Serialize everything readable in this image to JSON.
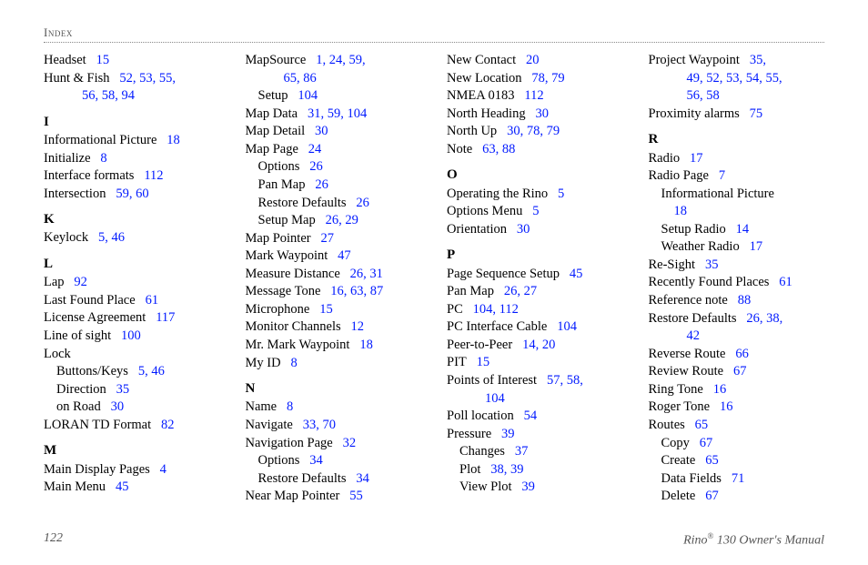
{
  "header": {
    "running": "Index"
  },
  "footer": {
    "page": "122",
    "title_pre": "Rino",
    "reg": "®",
    "title_post": " 130 Owner's Manual"
  },
  "cols": [
    [
      {
        "t": "entry",
        "term": "Headset",
        "pages": "15"
      },
      {
        "t": "entry",
        "term": "Hunt & Fish",
        "pages": "52, 53, 55,"
      },
      {
        "t": "cont",
        "pages": "56, 58, 94"
      },
      {
        "t": "letter",
        "text": "I"
      },
      {
        "t": "entry",
        "term": "Informational Picture",
        "pages": "18"
      },
      {
        "t": "entry",
        "term": "Initialize",
        "pages": "8"
      },
      {
        "t": "entry",
        "term": "Interface formats",
        "pages": "112"
      },
      {
        "t": "entry",
        "term": "Intersection",
        "pages": "59, 60"
      },
      {
        "t": "letter",
        "text": "K"
      },
      {
        "t": "entry",
        "term": "Keylock",
        "pages": "5, 46"
      },
      {
        "t": "letter",
        "text": "L"
      },
      {
        "t": "entry",
        "term": "Lap",
        "pages": "92"
      },
      {
        "t": "entry",
        "term": "Last Found Place",
        "pages": "61"
      },
      {
        "t": "entry",
        "term": "License Agreement",
        "pages": "117"
      },
      {
        "t": "entry",
        "term": "Line of sight",
        "pages": "100"
      },
      {
        "t": "entry",
        "term": "Lock",
        "pages": ""
      },
      {
        "t": "sub1",
        "term": "Buttons/Keys",
        "pages": "5, 46"
      },
      {
        "t": "sub1",
        "term": "Direction",
        "pages": "35"
      },
      {
        "t": "sub1",
        "term": "on Road",
        "pages": "30"
      },
      {
        "t": "entry",
        "term": "LORAN TD Format",
        "pages": "82"
      },
      {
        "t": "letter",
        "text": "M"
      },
      {
        "t": "entry",
        "term": "Main Display Pages",
        "pages": "4"
      },
      {
        "t": "entry",
        "term": "Main Menu",
        "pages": "45"
      }
    ],
    [
      {
        "t": "entry",
        "term": "MapSource",
        "pages": "1, 24, 59,"
      },
      {
        "t": "cont",
        "pages": "65, 86"
      },
      {
        "t": "sub1",
        "term": "Setup",
        "pages": "104"
      },
      {
        "t": "entry",
        "term": "Map Data",
        "pages": "31, 59, 104"
      },
      {
        "t": "entry",
        "term": "Map Detail",
        "pages": "30"
      },
      {
        "t": "entry",
        "term": "Map Page",
        "pages": "24"
      },
      {
        "t": "sub1",
        "term": "Options",
        "pages": "26"
      },
      {
        "t": "sub1",
        "term": "Pan Map",
        "pages": "26"
      },
      {
        "t": "sub1",
        "term": "Restore Defaults",
        "pages": "26"
      },
      {
        "t": "sub1",
        "term": "Setup Map",
        "pages": "26, 29"
      },
      {
        "t": "entry",
        "term": "Map Pointer",
        "pages": "27"
      },
      {
        "t": "entry",
        "term": "Mark Waypoint",
        "pages": "47"
      },
      {
        "t": "entry",
        "term": "Measure Distance",
        "pages": "26, 31"
      },
      {
        "t": "entry",
        "term": "Message Tone",
        "pages": "16, 63, 87"
      },
      {
        "t": "entry",
        "term": "Microphone",
        "pages": "15"
      },
      {
        "t": "entry",
        "term": "Monitor Channels",
        "pages": "12"
      },
      {
        "t": "entry",
        "term": "Mr. Mark Waypoint",
        "pages": "18"
      },
      {
        "t": "entry",
        "term": "My ID",
        "pages": "8"
      },
      {
        "t": "letter",
        "text": "N"
      },
      {
        "t": "entry",
        "term": "Name",
        "pages": "8"
      },
      {
        "t": "entry",
        "term": "Navigate",
        "pages": "33, 70"
      },
      {
        "t": "entry",
        "term": "Navigation Page",
        "pages": "32"
      },
      {
        "t": "sub1",
        "term": "Options",
        "pages": "34"
      },
      {
        "t": "sub1",
        "term": "Restore Defaults",
        "pages": "34"
      },
      {
        "t": "entry",
        "term": "Near Map Pointer",
        "pages": "55"
      }
    ],
    [
      {
        "t": "entry",
        "term": "New Contact",
        "pages": "20"
      },
      {
        "t": "entry",
        "term": "New Location",
        "pages": "78, 79"
      },
      {
        "t": "entry",
        "term": "NMEA 0183",
        "pages": "112"
      },
      {
        "t": "entry",
        "term": "North Heading",
        "pages": "30"
      },
      {
        "t": "entry",
        "term": "North Up",
        "pages": "30, 78, 79"
      },
      {
        "t": "entry",
        "term": "Note",
        "pages": "63, 88"
      },
      {
        "t": "letter",
        "text": "O"
      },
      {
        "t": "entry",
        "term": "Operating the Rino",
        "pages": "5"
      },
      {
        "t": "entry",
        "term": "Options Menu",
        "pages": "5"
      },
      {
        "t": "entry",
        "term": "Orientation",
        "pages": "30"
      },
      {
        "t": "letter",
        "text": "P"
      },
      {
        "t": "entry",
        "term": "Page Sequence Setup",
        "pages": "45"
      },
      {
        "t": "entry",
        "term": "Pan Map",
        "pages": "26, 27"
      },
      {
        "t": "entry",
        "term": "PC",
        "pages": "104, 112"
      },
      {
        "t": "entry",
        "term": "PC Interface Cable",
        "pages": "104"
      },
      {
        "t": "entry",
        "term": "Peer-to-Peer",
        "pages": "14, 20"
      },
      {
        "t": "entry",
        "term": "PIT",
        "pages": "15"
      },
      {
        "t": "entry",
        "term": "Points of Interest",
        "pages": "57, 58,"
      },
      {
        "t": "cont",
        "pages": "104"
      },
      {
        "t": "entry",
        "term": "Poll location",
        "pages": "54"
      },
      {
        "t": "entry",
        "term": "Pressure",
        "pages": "39"
      },
      {
        "t": "sub1",
        "term": "Changes",
        "pages": "37"
      },
      {
        "t": "sub1",
        "term": "Plot",
        "pages": "38, 39"
      },
      {
        "t": "sub1",
        "term": "View Plot",
        "pages": "39"
      }
    ],
    [
      {
        "t": "entry",
        "term": "Project Waypoint",
        "pages": "35,"
      },
      {
        "t": "cont",
        "pages": "49, 52, 53, 54, 55,"
      },
      {
        "t": "cont",
        "pages": "56, 58"
      },
      {
        "t": "entry",
        "term": "Proximity alarms",
        "pages": "75"
      },
      {
        "t": "letter",
        "text": "R"
      },
      {
        "t": "entry",
        "term": "Radio",
        "pages": "17"
      },
      {
        "t": "entry",
        "term": "Radio Page",
        "pages": "7"
      },
      {
        "t": "sub1",
        "term": "Informational Picture",
        "pages": ""
      },
      {
        "t": "cont2",
        "pages": "18"
      },
      {
        "t": "sub1",
        "term": "Setup Radio",
        "pages": "14"
      },
      {
        "t": "sub1",
        "term": "Weather Radio",
        "pages": "17"
      },
      {
        "t": "entry",
        "term": "Re-Sight",
        "pages": "35"
      },
      {
        "t": "entry",
        "term": "Recently Found Places",
        "pages": "61"
      },
      {
        "t": "entry",
        "term": "Reference note",
        "pages": "88"
      },
      {
        "t": "entry",
        "term": "Restore Defaults",
        "pages": "26, 38,"
      },
      {
        "t": "cont",
        "pages": "42"
      },
      {
        "t": "entry",
        "term": "Reverse Route",
        "pages": "66"
      },
      {
        "t": "entry",
        "term": "Review Route",
        "pages": "67"
      },
      {
        "t": "entry",
        "term": "Ring Tone",
        "pages": "16"
      },
      {
        "t": "entry",
        "term": "Roger Tone",
        "pages": "16"
      },
      {
        "t": "entry",
        "term": "Routes",
        "pages": "65"
      },
      {
        "t": "sub1",
        "term": "Copy",
        "pages": "67"
      },
      {
        "t": "sub1",
        "term": "Create",
        "pages": "65"
      },
      {
        "t": "sub1",
        "term": "Data Fields",
        "pages": "71"
      },
      {
        "t": "sub1",
        "term": "Delete",
        "pages": "67"
      }
    ]
  ]
}
